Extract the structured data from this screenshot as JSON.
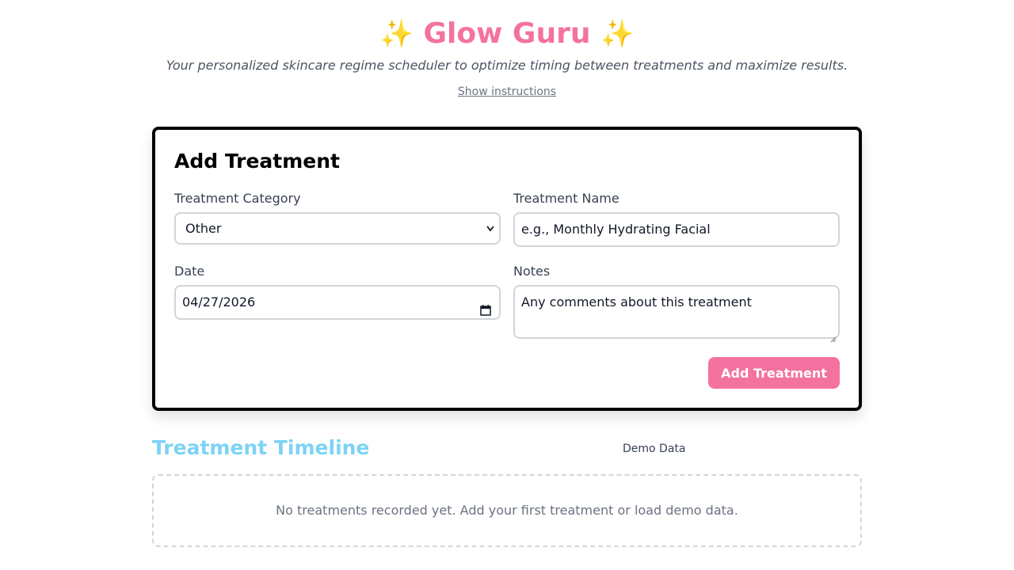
{
  "header": {
    "title": "Glow Guru",
    "sparkle_left": "✨",
    "sparkle_right": "✨",
    "subtitle": "Your personalized skincare regime scheduler to optimize timing between treatments and maximize results.",
    "instructions_link": "Show instructions"
  },
  "form": {
    "title": "Add Treatment",
    "category_label": "Treatment Category",
    "category_value": "Other",
    "name_label": "Treatment Name",
    "name_placeholder": "e.g., Monthly Hydrating Facial",
    "date_label": "Date",
    "date_value": "04/27/2026",
    "notes_label": "Notes",
    "notes_placeholder": "Any comments about this treatment",
    "submit_label": "Add Treatment"
  },
  "timeline": {
    "title": "Treatment Timeline",
    "demo_button": "Demo Data",
    "empty_message": "No treatments recorded yet. Add your first treatment or load demo data."
  },
  "colors": {
    "accent_pink": "#f472a0",
    "timeline_blue": "#7dd3f5"
  }
}
